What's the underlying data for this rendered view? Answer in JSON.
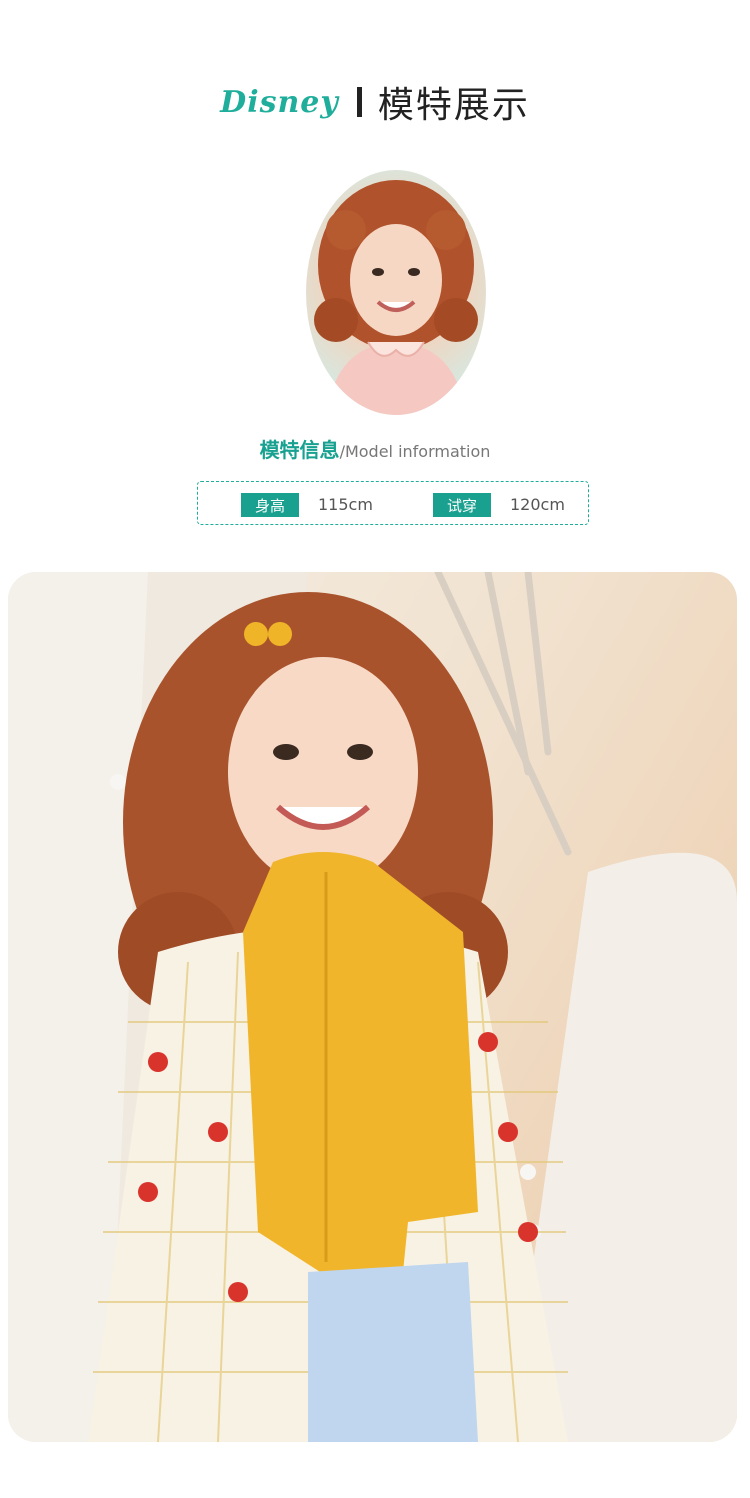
{
  "header": {
    "brand": "Disney",
    "title": "模特展示"
  },
  "model_info": {
    "heading_cn": "模特信息",
    "heading_en": "/Model information",
    "height_label": "身高",
    "height_value": "115cm",
    "size_label": "试穿",
    "size_value": "120cm"
  },
  "colors": {
    "accent": "#1fae9b",
    "tag_bg": "#1aa08f"
  }
}
